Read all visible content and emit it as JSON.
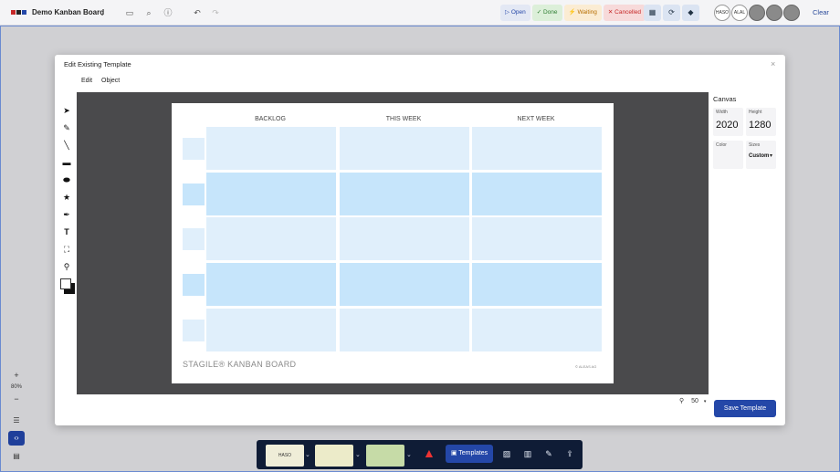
{
  "app": {
    "board_title": "Demo Kanban Board",
    "logo_colors": [
      "#c62828",
      "#222222",
      "#2447a8"
    ]
  },
  "topbar": {
    "icons": [
      "chevron-down-icon",
      "monitor-icon",
      "search-icon",
      "info-icon",
      "undo-icon",
      "redo-icon"
    ],
    "status_buttons": [
      {
        "label": "Open",
        "icon": "▷",
        "color": "#2447a8",
        "bg": "#e3e8f4"
      },
      {
        "label": "Done",
        "icon": "✓",
        "color": "#2e7d32",
        "bg": "#dcefd9"
      },
      {
        "label": "Waiting",
        "icon": "⚡",
        "color": "#b76e00",
        "bg": "#fbecd3"
      },
      {
        "label": "Cancelled",
        "icon": "✕",
        "color": "#c62828",
        "bg": "#f7dada"
      }
    ],
    "avatars": [
      "HASO",
      "ALAL"
    ],
    "clear_label": "Clear"
  },
  "zoom": {
    "value": "80%",
    "plus": "+",
    "minus": "−"
  },
  "bottom_bar": {
    "note_label": "HASO",
    "note_colors": [
      "#efedd8",
      "#ecebc9",
      "#c6dba7"
    ],
    "templates_label": "Templates"
  },
  "modal": {
    "title": "Edit Existing Template",
    "close": "×",
    "menu": [
      "Edit",
      "Object"
    ],
    "board": {
      "columns": [
        "BACKLOG",
        "THIS WEEK",
        "NEXT WEEK"
      ],
      "footer": "STAGILE® KANBAN BOARD",
      "copyright": "© ALEAS AG",
      "light_color": "#e0effb",
      "dark_color": "#c6e5fb"
    },
    "panel": {
      "title": "Canvas",
      "width_label": "Width",
      "width_value": "2020",
      "height_label": "Height",
      "height_value": "1280",
      "color_label": "Color",
      "sizes_label": "Sizes",
      "sizes_value": "Custom"
    },
    "zoom_value": "50",
    "save_label": "Save Template"
  }
}
